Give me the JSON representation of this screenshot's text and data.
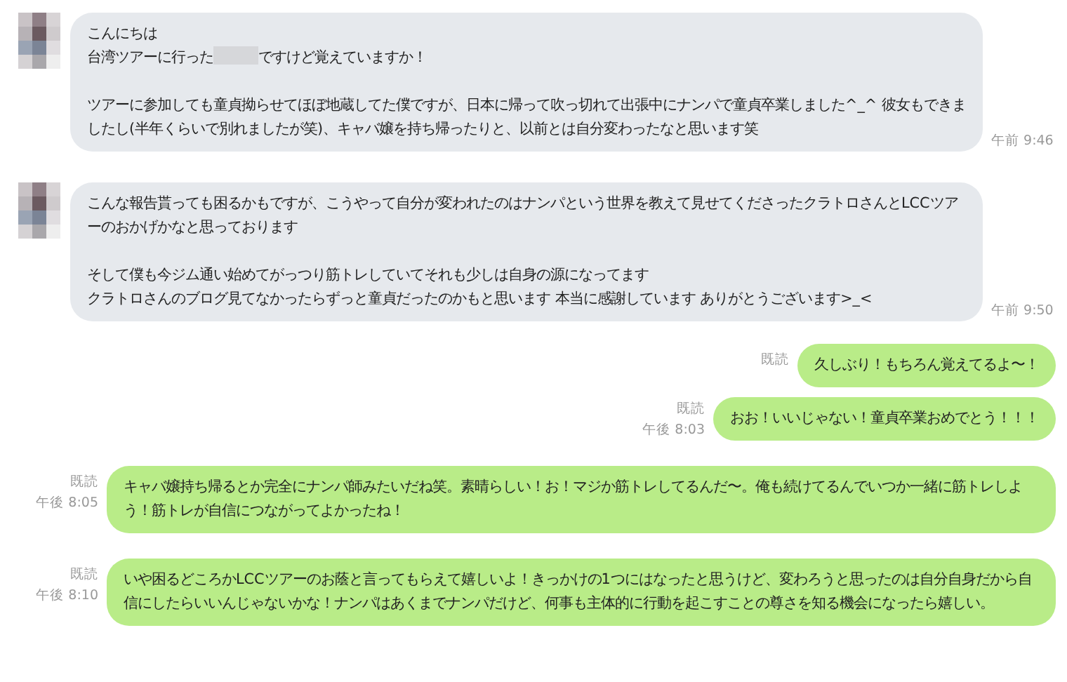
{
  "messages": [
    {
      "kind": "incoming",
      "time": "午前 9:46",
      "paragraphs": [
        [
          [
            {
              "kind": "text",
              "text": "こんにちは"
            }
          ],
          [
            {
              "kind": "text",
              "text": "台湾ツアーに行った"
            },
            {
              "kind": "redacted"
            },
            {
              "kind": "text",
              "text": "ですけど覚えていますか！"
            }
          ]
        ],
        [
          [
            {
              "kind": "text",
              "text": "ツアーに参加しても童貞拗らせてほぼ地蔵してた僕ですが、日本に帰って吹っ切れて出張中にナンパで童貞卒業しました^_^ 彼女もできましたし(半年くらいで別れましたが笑)、キャバ嬢を持ち帰ったりと、以前とは自分変わったなと思います笑"
            }
          ]
        ]
      ]
    },
    {
      "kind": "incoming",
      "time": "午前 9:50",
      "paragraphs": [
        [
          [
            {
              "kind": "text",
              "text": "こんな報告貰っても困るかもですが、こうやって自分が変われたのはナンパという世界を教えて見せてくださったクラトロさんとLCCツアーのおかげかなと思っております"
            }
          ]
        ],
        [
          [
            {
              "kind": "text",
              "text": "そして僕も今ジム通い始めてがっつり筋トレしていてそれも少しは自身の源になってます"
            }
          ],
          [
            {
              "kind": "text",
              "text": "クラトロさんのブログ見てなかったらずっと童貞だったのかもと思います 本当に感謝しています ありがとうございます>_<"
            }
          ]
        ]
      ]
    },
    {
      "kind": "outgoing",
      "read": "既読",
      "paragraphs": [
        [
          [
            {
              "kind": "text",
              "text": "久しぶり！もちろん覚えてるよ〜！"
            }
          ]
        ]
      ]
    },
    {
      "kind": "outgoing",
      "read": "既読",
      "time": "午後 8:03",
      "paragraphs": [
        [
          [
            {
              "kind": "text",
              "text": "おお！いいじゃない！童貞卒業おめでとう！！！"
            }
          ]
        ]
      ]
    },
    {
      "kind": "outgoing",
      "read": "既読",
      "time": "午後 8:05",
      "paragraphs": [
        [
          [
            {
              "kind": "text",
              "text": "キャバ嬢持ち帰るとか完全にナンパ師みたいだね笑。素晴らしい！お！マジか筋トレしてるんだ〜。俺も続けてるんでいつか一緒に筋トレしよう！筋トレが自信につながってよかったね！"
            }
          ]
        ]
      ]
    },
    {
      "kind": "outgoing",
      "read": "既読",
      "time": "午後 8:10",
      "paragraphs": [
        [
          [
            {
              "kind": "text",
              "text": "いや困るどころかLCCツアーのお蔭と言ってもらえて嬉しいよ！きっかけの1つにはなったと思うけど、変わろうと思ったのは自分自身だから自信にしたらいいんじゃないかな！ナンパはあくまでナンパだけど、何事も主体的に行動を起こすことの尊さを知る機会になったら嬉しい。"
            }
          ]
        ]
      ]
    }
  ]
}
